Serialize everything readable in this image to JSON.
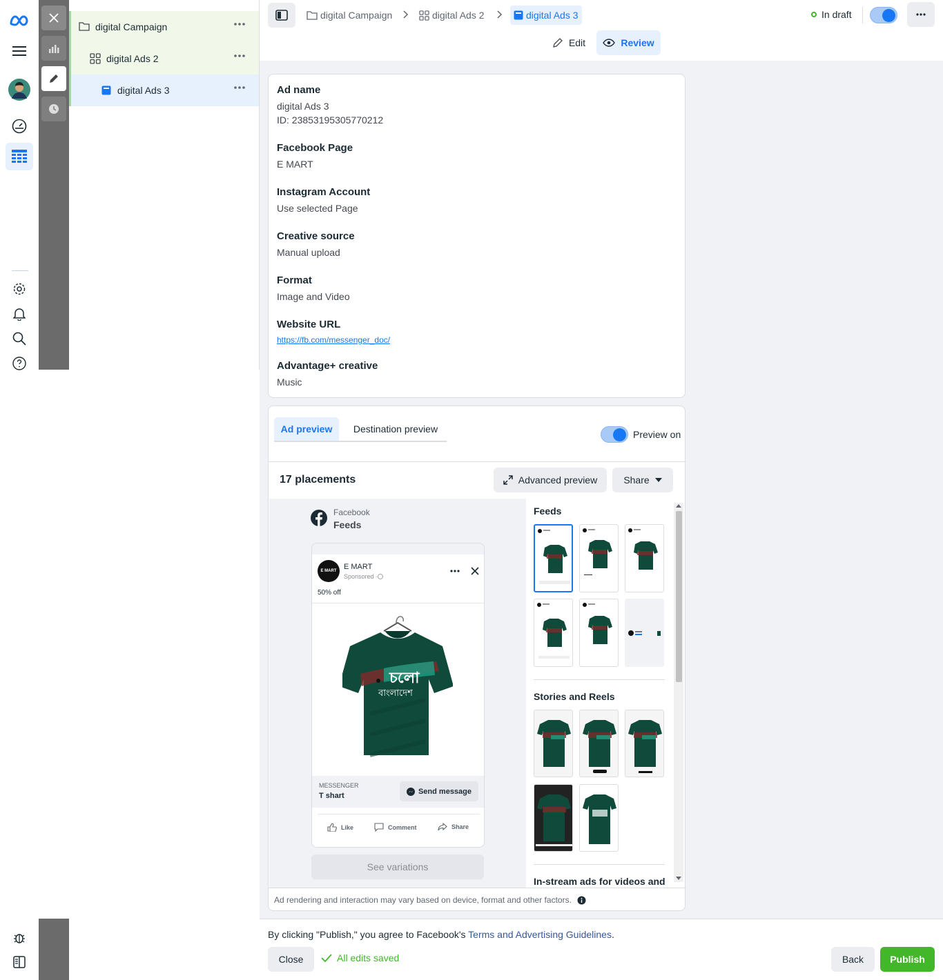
{
  "tree": {
    "campaign": "digital Campaign",
    "adset": "digital Ads 2",
    "ad": "digital Ads 3"
  },
  "breadcrumb": {
    "campaign": "digital Campaign",
    "adset": "digital Ads 2",
    "ad": "digital Ads 3"
  },
  "status": {
    "label": "In draft"
  },
  "modes": {
    "edit": "Edit",
    "review": "Review"
  },
  "details": {
    "ad_name_label": "Ad name",
    "ad_name_value": "digital Ads 3",
    "ad_id": "ID: 23853195305770212",
    "fb_page_label": "Facebook Page",
    "fb_page_value": "E MART",
    "ig_label": "Instagram Account",
    "ig_value": "Use selected Page",
    "creative_label": "Creative source",
    "creative_value": "Manual upload",
    "format_label": "Format",
    "format_value": "Image and Video",
    "url_label": "Website URL",
    "url_value": "https://fb.com/messenger_doc/",
    "advantage_label": "Advantage+ creative",
    "advantage_value": "Music"
  },
  "preview": {
    "tab_ad": "Ad preview",
    "tab_dest": "Destination preview",
    "toggle_label": "Preview on",
    "placements_count": "17 placements",
    "advanced_btn": "Advanced preview",
    "share_btn": "Share",
    "platform": "Facebook",
    "placement": "Feeds",
    "page_name": "E MART",
    "sponsored": "Sponsored · ",
    "primary_text": "50% off",
    "cta_source": "MESSENGER",
    "cta_headline": "T shart",
    "cta_button": "Send message",
    "like": "Like",
    "comment": "Comment",
    "share": "Share",
    "variations": "See variations",
    "logo_text": "E MART",
    "disclaimer": "Ad rendering and interaction may vary based on device, format and other factors."
  },
  "placements": {
    "feeds_title": "Feeds",
    "stories_title": "Stories and Reels",
    "instream_title": "In-stream ads for videos and"
  },
  "footer": {
    "agree_prefix": "By clicking \"Publish,\" you agree to Facebook's ",
    "agree_link": "Terms and Advertising Guidelines",
    "agree_suffix": ".",
    "close": "Close",
    "saved": "All edits saved",
    "back": "Back",
    "publish": "Publish"
  },
  "colors": {
    "accent": "#1877f2",
    "publish_green": "#42b72a",
    "tshirt_green": "#0f4a3a",
    "draft_green": "#42b72a"
  },
  "icons": [
    "meta-logo-icon",
    "menu-icon",
    "avatar",
    "gauge-icon",
    "table-icon",
    "gear-icon",
    "bell-icon",
    "search-icon",
    "help-icon",
    "bug-icon",
    "panel-icon",
    "close-icon",
    "chart-icon",
    "pencil-icon",
    "clock-icon",
    "folder-icon",
    "grid-icon",
    "ad-icon",
    "more-icon",
    "chevron-right-icon",
    "eye-icon",
    "expand-icon",
    "caret-down-icon",
    "info-icon",
    "check-icon",
    "messenger-icon",
    "facebook-icon"
  ]
}
